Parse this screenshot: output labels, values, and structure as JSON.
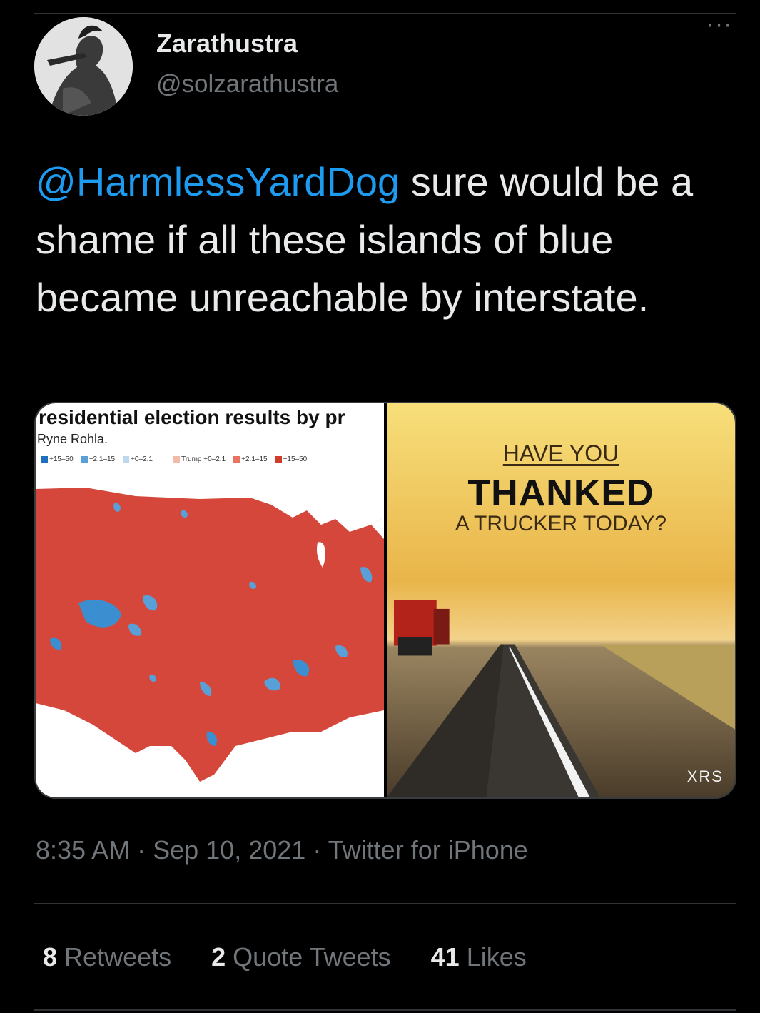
{
  "author": {
    "display_name": "Zarathustra",
    "handle": "@solzarathustra"
  },
  "tweet": {
    "mention": "@HarmlessYardDog",
    "text": " sure would be a shame if all these islands of blue became unreachable by interstate."
  },
  "media": {
    "left_image": {
      "title": "residential election results by pr",
      "credit": "Ryne Rohla.",
      "legend": [
        {
          "label": "+15–50",
          "color": "#1f6fbf"
        },
        {
          "label": "+2.1–15",
          "color": "#5aa0d8"
        },
        {
          "label": "+0–2.1",
          "color": "#bcd8ef"
        },
        {
          "label": "Trump +0–2.1",
          "color": "#f3b9ab"
        },
        {
          "label": "+2.1–15",
          "color": "#e8735f"
        },
        {
          "label": "+15–50",
          "color": "#d13b2c"
        }
      ]
    },
    "right_image": {
      "line1": "HAVE YOU",
      "line2": "THANKED",
      "line3": "A TRUCKER TODAY?",
      "logo": "XRS"
    }
  },
  "meta": {
    "time": "8:35 AM",
    "date": "Sep 10, 2021",
    "source": "Twitter for iPhone"
  },
  "stats": {
    "retweets_count": "8",
    "retweets_label": "Retweets",
    "quotes_count": "2",
    "quotes_label": "Quote Tweets",
    "likes_count": "41",
    "likes_label": "Likes"
  },
  "colors": {
    "accent": "#1d9bf0",
    "background": "#000000",
    "text": "#e7e9ea",
    "muted": "#71767b"
  }
}
